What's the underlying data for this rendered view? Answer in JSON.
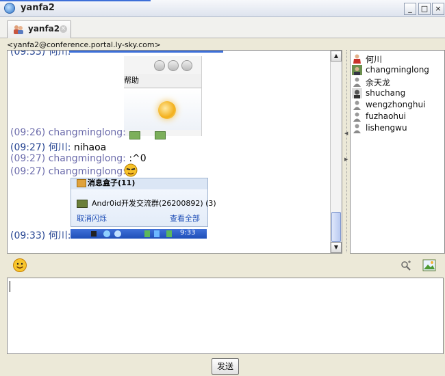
{
  "window": {
    "title": "yanfa2",
    "buttons": {
      "minimize": "_",
      "maximize": "□",
      "close": "×"
    }
  },
  "tab": {
    "label": "yanfa2",
    "close": "×"
  },
  "room_jid": "<yanfa2@conference.portal.ly-sky.com>",
  "messages": [
    {
      "time": "(09:26)",
      "nick": "changminglong:",
      "text": "",
      "self": false
    },
    {
      "time": "(09:27)",
      "nick": "何川:",
      "text": "nihaoa",
      "self": true
    },
    {
      "time": "(09:27)",
      "nick": "changminglong:",
      "text": ":^0",
      "self": false
    },
    {
      "time": "(09:27)",
      "nick": "changminglong:",
      "text": "",
      "self": false
    },
    {
      "time": "(09:33)",
      "nick": "何川:",
      "text": "",
      "self": true
    }
  ],
  "embedded_image1": {
    "menu_text": "帮助"
  },
  "embedded_image2": {
    "title": "消息盒子(11)",
    "group": "Andr0id开发交流群(26200892) (3)",
    "cancel": "取消闪烁",
    "view_all": "查看全部"
  },
  "embedded_image3": {
    "clock": "9:33"
  },
  "roster": [
    {
      "name": "何川",
      "icon": "user-avatar-redshirt"
    },
    {
      "name": "changminglong",
      "icon": "user-avatar-photo"
    },
    {
      "name": "余天龙",
      "icon": "user-avatar-gray"
    },
    {
      "name": "shuchang",
      "icon": "user-avatar-bw-photo"
    },
    {
      "name": "wengzhonghui",
      "icon": "user-avatar-gray"
    },
    {
      "name": "fuzhaohui",
      "icon": "user-avatar-gray"
    },
    {
      "name": "lishengwu",
      "icon": "user-avatar-gray"
    }
  ],
  "send_button": "发送",
  "colors": {
    "accent": "#3d6fd8",
    "nick_other": "#6b6bab",
    "nick_self": "#1f3f8f"
  }
}
